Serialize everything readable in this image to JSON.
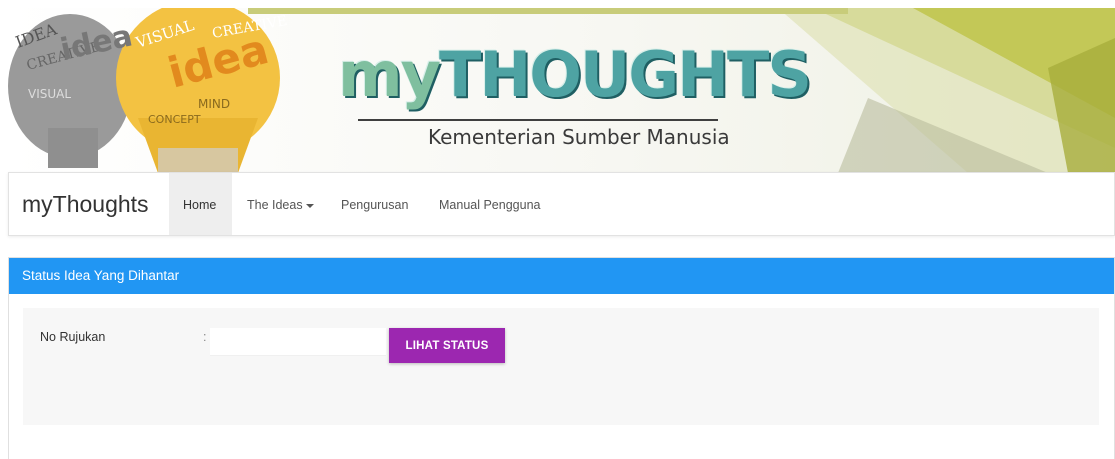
{
  "banner": {
    "logo_title_my": "my",
    "logo_title_thoughts": "THOUGHTS",
    "logo_subtitle": "Kementerian Sumber Manusia",
    "artwork_words": [
      "IDEA",
      "CREATIVE",
      "idea",
      "VISUAL",
      "CONCEPT",
      "MIND"
    ]
  },
  "navbar": {
    "brand": "myThoughts",
    "items": [
      {
        "label": "Home",
        "active": true
      },
      {
        "label": "The Ideas",
        "has_dropdown": true
      },
      {
        "label": "Pengurusan"
      },
      {
        "label": "Manual Pengguna"
      }
    ]
  },
  "panel": {
    "title": "Status Idea Yang Dihantar",
    "form": {
      "label": "No Rujukan",
      "separator": ":",
      "input_value": "",
      "input_placeholder": "",
      "button_label": "LIHAT STATUS"
    }
  },
  "colors": {
    "panel_header": "#2196f3",
    "button": "#9c27b0",
    "banner_accent": "#b8c24a",
    "logo_teal": "#4ea3a3"
  }
}
